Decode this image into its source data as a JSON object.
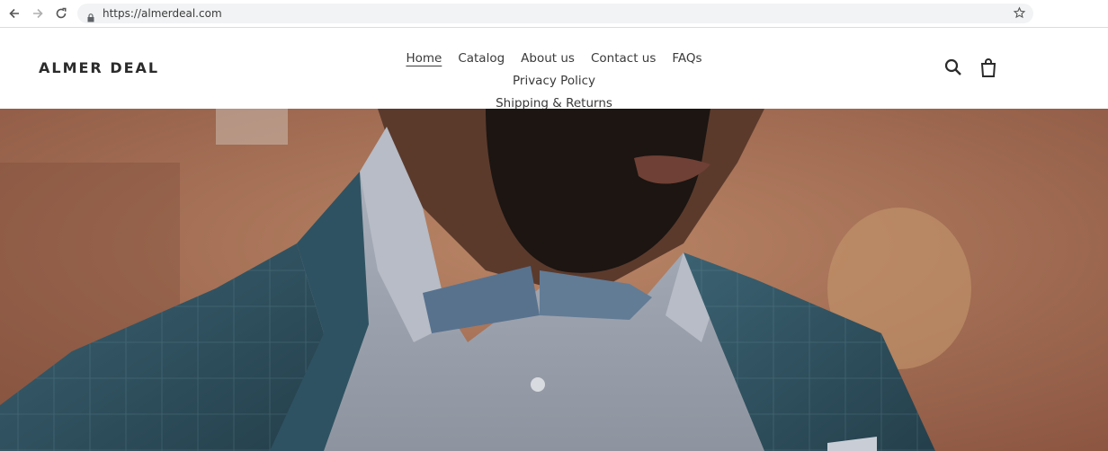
{
  "browser": {
    "url": "https://almerdeal.com",
    "icons": [
      "back-arrow-icon",
      "forward-arrow-icon",
      "reload-icon",
      "lock-icon",
      "bookmark-star-icon"
    ]
  },
  "store": {
    "name": "ALMER DEAL",
    "menu": [
      {
        "label": "Home",
        "active": true
      },
      {
        "label": "Catalog"
      },
      {
        "label": "About us"
      },
      {
        "label": "Contact us"
      },
      {
        "label": "FAQs"
      },
      {
        "label": "Privacy Policy"
      },
      {
        "label": "Shipping & Returns"
      }
    ],
    "icons": [
      "search-icon",
      "cart-icon"
    ]
  },
  "colors": {
    "text": "#3a3a3a",
    "omnibox": "#f1f3f4",
    "jacket": "#2f4f5e",
    "brick": "#9c5f45"
  }
}
